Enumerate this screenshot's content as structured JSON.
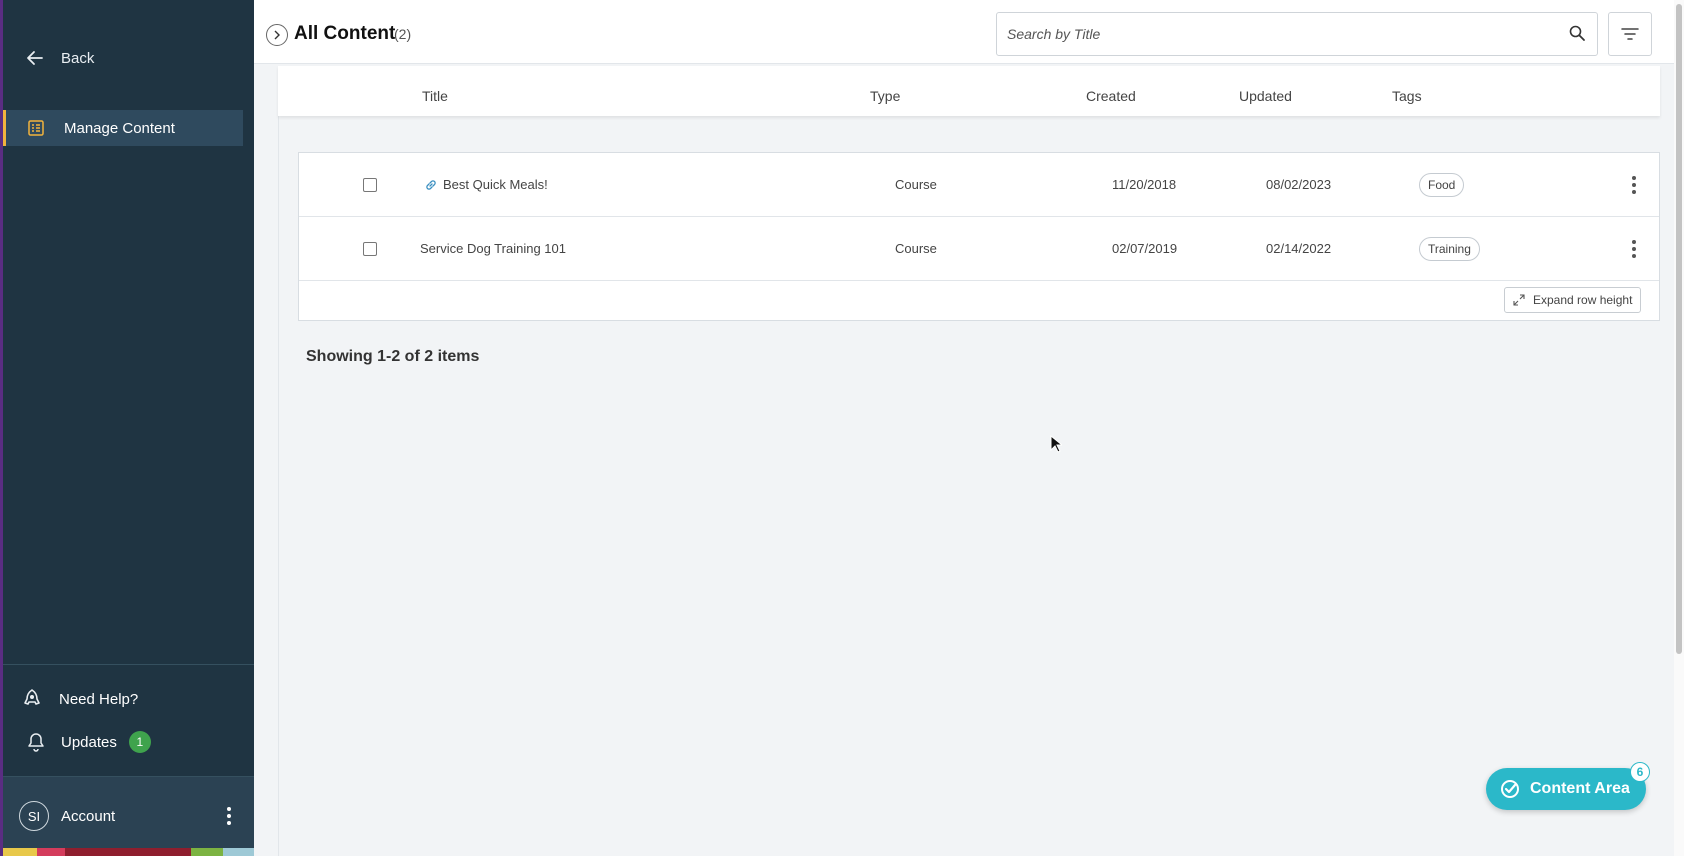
{
  "sidebar": {
    "back_label": "Back",
    "nav_item_label": "Manage Content",
    "help_label": "Need Help?",
    "updates_label": "Updates",
    "updates_count": "1",
    "account_initials": "SI",
    "account_label": "Account",
    "colors": {
      "background": "#1f3442",
      "active": "#2f4a5e",
      "accent": "#f2b33d",
      "badge": "#3fa34d"
    }
  },
  "header": {
    "title": "All Content",
    "count": "(2)",
    "search_placeholder": "Search by Title"
  },
  "table": {
    "columns": [
      "Title",
      "Type",
      "Created",
      "Updated",
      "Tags"
    ],
    "rows": [
      {
        "title": "Best Quick Meals!",
        "type": "Course",
        "created": "11/20/2018",
        "updated": "08/02/2023",
        "tag": "Food",
        "icon": "link-icon"
      },
      {
        "title": "Service Dog Training 101",
        "type": "Course",
        "created": "02/07/2019",
        "updated": "02/14/2022",
        "tag": "Training"
      }
    ],
    "expand_label": "Expand row height"
  },
  "footer": {
    "showing": "Showing 1-2 of 2 items"
  },
  "fab": {
    "label": "Content Area",
    "badge": "6",
    "color": "#2bb8c9"
  }
}
